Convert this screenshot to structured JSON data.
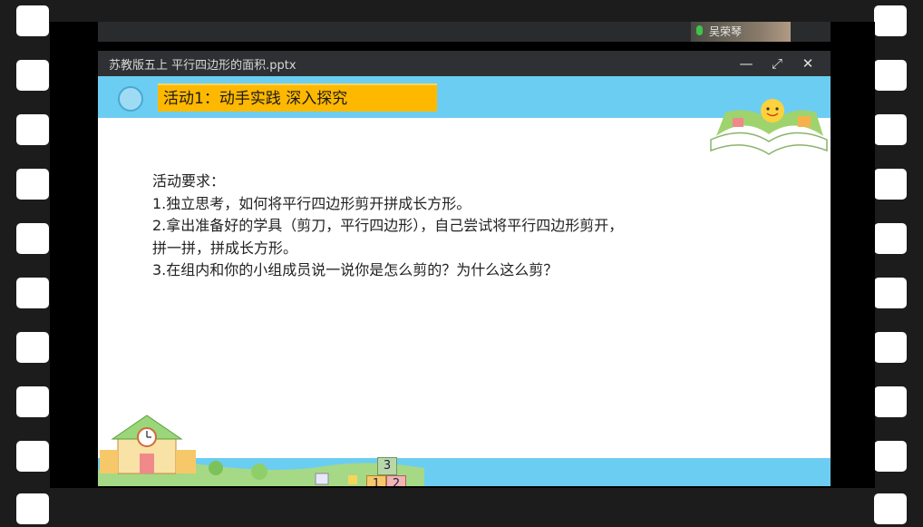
{
  "window": {
    "title": "苏教版五上 平行四边形的面积.pptx",
    "speaker_name": "吴荣琴",
    "controls": {
      "minimize": "—",
      "restore": "⤢",
      "close": "✕"
    }
  },
  "slide": {
    "activity_title": "活动1：动手实践 深入探究",
    "requirements_heading": "活动要求：",
    "requirements": [
      "1.独立思考，如何将平行四边形剪开拼成长方形。",
      "2.拿出准备好的学具（剪刀，平行四边形），自己尝试将平行四边形剪开，",
      "拼一拼，拼成长方形。",
      "3.在组内和你的小组成员说一说你是怎么剪的？为什么这么剪？"
    ],
    "decorations": {
      "blocks": [
        "3",
        "1",
        "2"
      ]
    }
  },
  "icons": [
    "microphone-icon",
    "minimize-icon",
    "restore-icon",
    "close-icon"
  ],
  "colors": {
    "sky_band": "#6ccdf2",
    "header_box": "#ffb800",
    "mic": "#3ec44a",
    "titlebar": "#2e3033"
  }
}
